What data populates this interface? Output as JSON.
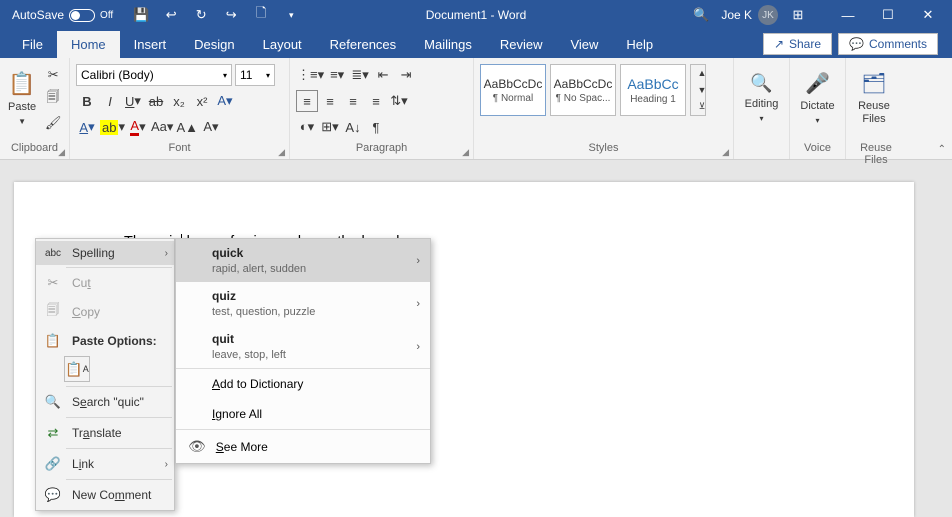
{
  "titlebar": {
    "autosave_label": "AutoSave",
    "autosave_state": "Off",
    "doc_title": "Document1  -  Word",
    "user_name": "Joe K",
    "user_initials": "JK"
  },
  "tabs": {
    "items": [
      "File",
      "Home",
      "Insert",
      "Design",
      "Layout",
      "References",
      "Mailings",
      "Review",
      "View",
      "Help"
    ],
    "active": "Home",
    "share_label": "Share",
    "comments_label": "Comments"
  },
  "ribbon": {
    "clipboard": {
      "label": "Clipboard",
      "paste": "Paste"
    },
    "font": {
      "label": "Font",
      "family": "Calibri (Body)",
      "size": "11"
    },
    "paragraph": {
      "label": "Paragraph"
    },
    "styles": {
      "label": "Styles",
      "items": [
        {
          "preview": "AaBbCcDc",
          "name": "¶ Normal"
        },
        {
          "preview": "AaBbCcDc",
          "name": "¶ No Spac..."
        },
        {
          "preview": "AaBbCc",
          "name": "Heading 1"
        }
      ]
    },
    "editing": {
      "label": "Editing"
    },
    "voice": {
      "label": "Voice",
      "dictate": "Dictate"
    },
    "reuse": {
      "label": "Reuse Files",
      "btn": "Reuse\nFiles"
    }
  },
  "document": {
    "before": "The ",
    "misspelled": "quic",
    "after": " brown fox jumped over the lazy dog."
  },
  "context_menu": {
    "spelling": "Spelling",
    "cut": "Cut",
    "copy": "Copy",
    "paste_options": "Paste Options:",
    "search": "Search \"quic\"",
    "translate": "Translate",
    "link": "Link",
    "new_comment": "New Comment"
  },
  "spelling_menu": {
    "suggestions": [
      {
        "word": "quick",
        "synonyms": "rapid, alert, sudden"
      },
      {
        "word": "quiz",
        "synonyms": "test, question, puzzle"
      },
      {
        "word": "quit",
        "synonyms": "leave, stop, left"
      }
    ],
    "add_dict": "Add to Dictionary",
    "ignore_all": "Ignore All",
    "see_more": "See More"
  }
}
